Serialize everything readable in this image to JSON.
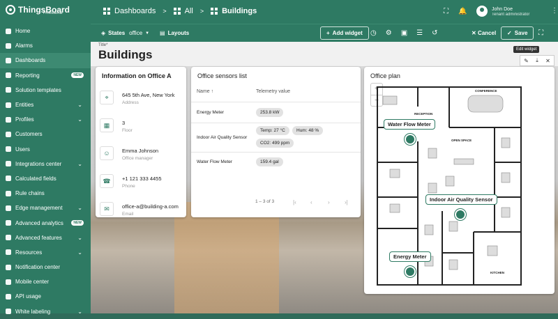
{
  "header": {
    "brand": "ThingsBoard",
    "brand_sub": "Professional",
    "breadcrumb": [
      "Dashboards",
      "All",
      "Buildings"
    ],
    "user_name": "John Doe",
    "user_role": "Tenant administrator"
  },
  "sidebar": {
    "items": [
      {
        "label": "Home",
        "active": false,
        "chevron": false,
        "badge": ""
      },
      {
        "label": "Alarms",
        "active": false,
        "chevron": false,
        "badge": ""
      },
      {
        "label": "Dashboards",
        "active": true,
        "chevron": false,
        "badge": ""
      },
      {
        "label": "Reporting",
        "active": false,
        "chevron": false,
        "badge": "NEW"
      },
      {
        "label": "Solution templates",
        "active": false,
        "chevron": false,
        "badge": ""
      },
      {
        "label": "Entities",
        "active": false,
        "chevron": true,
        "badge": ""
      },
      {
        "label": "Profiles",
        "active": false,
        "chevron": true,
        "badge": ""
      },
      {
        "label": "Customers",
        "active": false,
        "chevron": false,
        "badge": ""
      },
      {
        "label": "Users",
        "active": false,
        "chevron": false,
        "badge": ""
      },
      {
        "label": "Integrations center",
        "active": false,
        "chevron": true,
        "badge": ""
      },
      {
        "label": "Calculated fields",
        "active": false,
        "chevron": false,
        "badge": ""
      },
      {
        "label": "Rule chains",
        "active": false,
        "chevron": false,
        "badge": ""
      },
      {
        "label": "Edge management",
        "active": false,
        "chevron": true,
        "badge": ""
      },
      {
        "label": "Advanced analytics",
        "active": false,
        "chevron": false,
        "badge": "NEW"
      },
      {
        "label": "Advanced features",
        "active": false,
        "chevron": true,
        "badge": ""
      },
      {
        "label": "Resources",
        "active": false,
        "chevron": true,
        "badge": ""
      },
      {
        "label": "Notification center",
        "active": false,
        "chevron": false,
        "badge": ""
      },
      {
        "label": "Mobile center",
        "active": false,
        "chevron": false,
        "badge": ""
      },
      {
        "label": "API usage",
        "active": false,
        "chevron": false,
        "badge": ""
      },
      {
        "label": "White labeling",
        "active": false,
        "chevron": true,
        "badge": ""
      }
    ]
  },
  "toolbar": {
    "states_label": "States",
    "state_value": "office",
    "layouts_label": "Layouts",
    "add_widget_label": "Add widget",
    "cancel_label": "Cancel",
    "save_label": "Save"
  },
  "dashboard": {
    "title_label": "Title*",
    "title_value": "Buildings",
    "edit_tooltip": "Edit widget"
  },
  "info_card": {
    "title": "Information on Office A",
    "rows": [
      {
        "icon": "location-pin-icon",
        "value": "645 5th Ave, New York",
        "label": "Address"
      },
      {
        "icon": "floor-icon",
        "value": "3",
        "label": "Floor"
      },
      {
        "icon": "person-icon",
        "value": "Emma Johnson",
        "label": "Office manager"
      },
      {
        "icon": "phone-icon",
        "value": "+1 121 333 4455",
        "label": "Phone"
      },
      {
        "icon": "email-icon",
        "value": "office-a@building-a.com",
        "label": "Email"
      }
    ]
  },
  "sensors_card": {
    "title": "Office sensors list",
    "col_name": "Name",
    "col_value": "Telemetry value",
    "rows": [
      {
        "name": "Energy Meter",
        "chips": [
          "253.8 kW"
        ]
      },
      {
        "name": "Indoor Air Quality Sensor",
        "chips": [
          "Temp: 27 °C",
          "Hum: 48 %",
          "CO2: 499 ppm"
        ]
      },
      {
        "name": "Water Flow Meter",
        "chips": [
          "159.4 gal"
        ]
      }
    ],
    "pager_text": "1 – 3 of 3"
  },
  "plan_card": {
    "title": "Office plan",
    "zoom_in": "+",
    "zoom_out": "−",
    "rooms": [
      "CONFERENCE",
      "RECEPTION",
      "OPEN SPACE",
      "KITCHEN"
    ],
    "markers": [
      "Water Flow Meter",
      "Indoor Air Quality Sensor",
      "Energy Meter"
    ]
  }
}
